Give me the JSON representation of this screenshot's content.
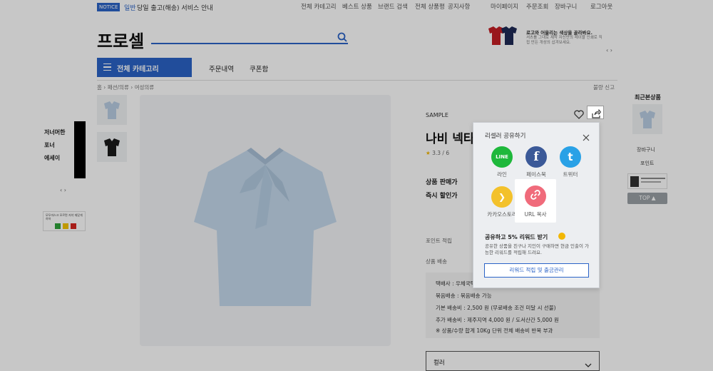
{
  "topbar": {
    "notice_badge": "NOTICE",
    "notice_category": "일반",
    "notice_text": "당일 출고(해송) 서비스 안내",
    "menu": [
      "전체 카테고리",
      "베스트 상품",
      "브랜드 검색",
      "전체 상품평",
      "공지사항",
      "마이페이지",
      "주문조회",
      "장바구니",
      "로그아웃"
    ]
  },
  "header": {
    "logo": "프로셀",
    "promo_title": "로고와 어울리는 색상을 골라봐요.",
    "promo_sub": "셔츠를 그대로 제작 자신만의 레이블 인쇄로 직접 만든 개성의 삽겨보세요."
  },
  "nav": {
    "category_button": "전체 카테고리",
    "links": [
      "주문내역",
      "쿠폰함"
    ]
  },
  "breadcrumb": [
    "홈",
    "패션/의류",
    "여성의류"
  ],
  "report_link": "불량 신고",
  "left_banner": {
    "lines": [
      "저너머한",
      "포너",
      "에세이"
    ],
    "arrows": "‹ ›",
    "badge_text": "모두마스크 모르면 저녁 재밌게 하하"
  },
  "product": {
    "brand": "SAMPLE",
    "name": "나비 넥타이 블라우스",
    "rating": "3.3 / 6",
    "price_label": "상품 판매가",
    "discount_label": "즉시 할인가",
    "point_label": "포인트 적립",
    "shipping_label": "상품 배송",
    "shipping_lines": [
      "택배사 : 우체국택배",
      "묶음배송 : 묶음배송 가능",
      "기본 배송비 : 2,500 원 (무료배송 조건 미달 시 선불)",
      "추가 배송비 : 제주지역 4,000 원 / 도서산간 5,000 원",
      "※ 상품/수량 합계 10Kg 단위 전체 배송비 반복 부과"
    ],
    "option_select": "컬러"
  },
  "share_popup": {
    "title": "리셀러 공유하기",
    "items": [
      {
        "label": "라인",
        "color": "#1eb83b",
        "glyph": "LINE"
      },
      {
        "label": "페이스북",
        "color": "#3b5998",
        "glyph": "f"
      },
      {
        "label": "트위터",
        "color": "#29a1e6",
        "glyph": "t"
      },
      {
        "label": "카카오스토리",
        "color": "#f3c12b",
        "glyph": "❯"
      },
      {
        "label": "URL 복사",
        "color": "#f06b7b",
        "glyph": "⛓"
      }
    ],
    "reward_title": "공유하고 5% 리워드 받기",
    "reward_desc": "공유한 상품을 친구나 지인이 구매하면 현금 인출이 가능한 리워드를 적립해 드려요.",
    "reward_button": "리워드 적립 및 출금관리"
  },
  "right_sidebar": {
    "recent_title": "최근본상품",
    "cart": "장바구니",
    "recent_label": "포인트",
    "top_button": "TOP ▲"
  }
}
